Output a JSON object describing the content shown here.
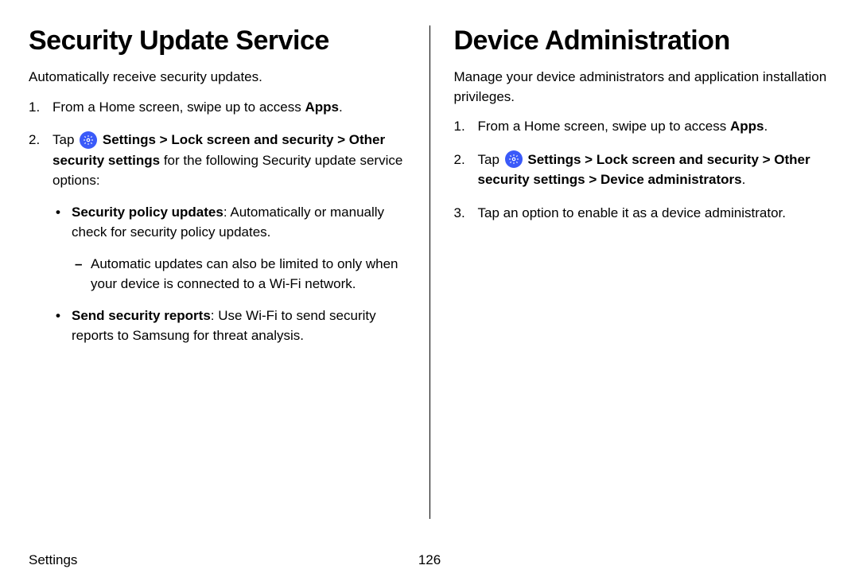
{
  "left": {
    "heading": "Security Update Service",
    "intro": "Automatically receive security updates.",
    "step1_pre": "From a Home screen, swipe up to access ",
    "step1_bold": "Apps",
    "step1_post": ".",
    "step2_pre": "Tap ",
    "step2_bold1": "Settings",
    "step2_gt1": " > ",
    "step2_bold2": "Lock screen and security",
    "step2_gt2": " > ",
    "step2_bold3": "Other security settings",
    "step2_post": " for the following Security update service options:",
    "bullet1_bold": "Security policy updates",
    "bullet1_post": ": Automatically or manually check for security policy updates.",
    "dash1": "Automatic updates can also be limited to only when your device is connected to a Wi‑Fi network.",
    "bullet2_bold": "Send security reports",
    "bullet2_post": ": Use Wi‑Fi to send security reports to Samsung for threat analysis."
  },
  "right": {
    "heading": "Device Administration",
    "intro": "Manage your device administrators and application installation privileges.",
    "step1_pre": "From a Home screen, swipe up to access ",
    "step1_bold": "Apps",
    "step1_post": ".",
    "step2_pre": "Tap ",
    "step2_bold1": "Settings",
    "step2_gt1": " > ",
    "step2_bold2": "Lock screen and security",
    "step2_gt2": " > ",
    "step2_bold3": "Other security settings",
    "step2_gt3": " > ",
    "step2_bold4": "Device administrators",
    "step2_post": ".",
    "step3": "Tap an option to enable it as a device administrator."
  },
  "footer": {
    "section": "Settings",
    "page": "126"
  }
}
